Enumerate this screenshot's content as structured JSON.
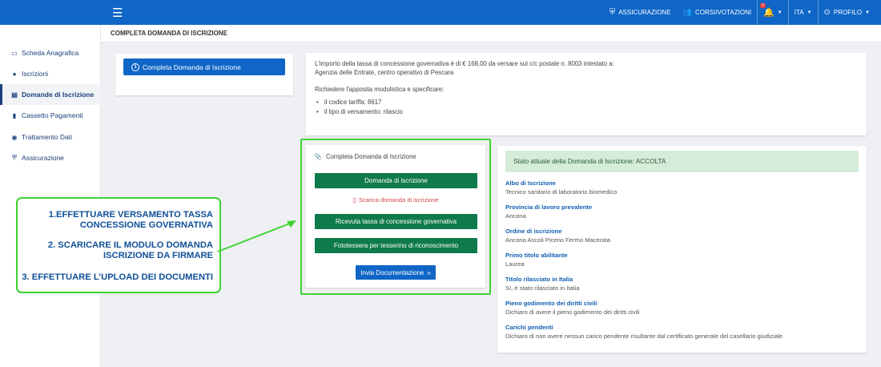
{
  "topbar": {
    "nav": [
      {
        "icon": "shield-icon",
        "label": "ASSICURAZIONE"
      },
      {
        "icon": "people-icon",
        "label": "CORSI/VOTAZIONI"
      }
    ],
    "notifications_badge": "0",
    "language": "ITA",
    "profile": "PROFILO"
  },
  "sidebar": {
    "items": [
      {
        "icon": "id-card-icon",
        "label": "Scheda Anagrafica"
      },
      {
        "icon": "user-icon",
        "label": "Iscrizioni"
      },
      {
        "icon": "document-icon",
        "label": "Domande di Iscrizione",
        "active": true
      },
      {
        "icon": "file-icon",
        "label": "Cassetto Pagamenti"
      },
      {
        "icon": "eye-icon",
        "label": "Trattamento Dati"
      },
      {
        "icon": "shield-icon",
        "label": "Assicurazione"
      }
    ]
  },
  "breadcrumb": "COMPLETA DOMANDA DI ISCRIZIONE",
  "step_card": {
    "number": "1",
    "label": "Completa Domanda di Iscrizione"
  },
  "info": {
    "line1": "L'importo della tassa di concessione governativa è di € 168,00 da versare sul c/c postale n. 8003 intestato a:",
    "line2": "Agenzia delle Entrate, centro operativo di Pescara",
    "line3": "Richiedere l'apposita modulistica e specificare:",
    "bullets": [
      "il codice tariffa: 8617",
      "il tipo di versamento: rilascio"
    ]
  },
  "upload_card": {
    "title": "Completa Domanda di Iscrizione",
    "btn_domanda": "Domanda di iscrizione",
    "download_link": "Scarica domanda di iscrizione",
    "btn_ricevuta": "Ricevuta tassa di concessione governativa",
    "btn_foto": "Fototessera per tesserino di riconoscimento",
    "btn_invia": "Invia Documentazione"
  },
  "status": {
    "text": "Stato attuale della Domanda di Iscrizione: ACCOLTA"
  },
  "details": [
    {
      "label": "Albo di Iscrizione",
      "value": "Tecnico sanitario di laboratorio biomedico"
    },
    {
      "label": "Provincia di lavoro prevalente",
      "value": "Ancona"
    },
    {
      "label": "Ordine di iscrizione",
      "value": "Ancona Ascoli Piceno Fermo Macerata"
    },
    {
      "label": "Primo titolo abilitante",
      "value": "Laurea"
    },
    {
      "label": "Titolo rilasciato in Italia",
      "value": "Sì, è stato rilasciato in Italia"
    },
    {
      "label": "Pieno godimento dei diritti civili",
      "value": "Dichiaro di avere il pieno godimento dei diritti civili"
    },
    {
      "label": "Carichi pendenti",
      "value": "Dichiaro di non avere nessun carico pendente risultante dal certificato generale del casellario giudiziale"
    }
  ],
  "annotation": {
    "lines": [
      "1.EFFETTUARE VERSAMENTO TASSA",
      "CONCESSIONE GOVERNATIVA",
      "2. SCARICARE IL MODULO DOMANDA",
      "ISCRIZIONE DA FIRMARE",
      "3. EFFETTUARE L’UPLOAD DEI DOCUMENTI"
    ]
  }
}
